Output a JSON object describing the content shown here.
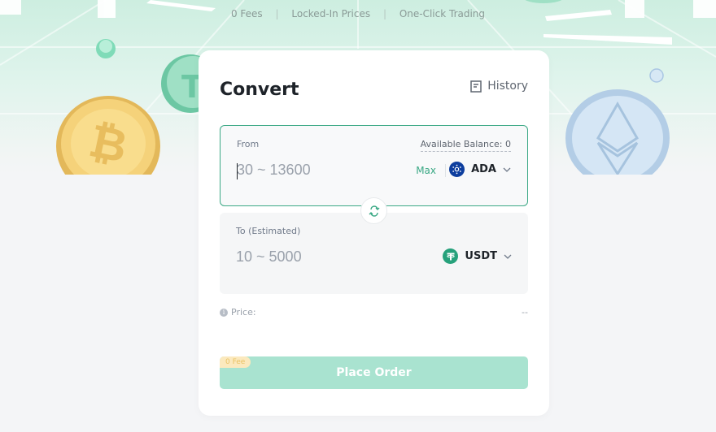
{
  "features": [
    "0 Fees",
    "Locked-In Prices",
    "One-Click Trading"
  ],
  "convert": {
    "title": "Convert",
    "history_label": "History",
    "from": {
      "label": "From",
      "balance": "Available Balance: 0",
      "placeholder": "30 ~ 13600",
      "max_label": "Max",
      "coin": "ADA"
    },
    "to": {
      "label": "To (Estimated)",
      "placeholder": "10 ~ 5000",
      "coin": "USDT"
    },
    "price_label": "Price:",
    "price_value": "--",
    "fee_badge": "0 Fee",
    "order_button": "Place Order"
  },
  "colors": {
    "accent": "#3aa884",
    "order_button_bg": "#a9e3d0",
    "ada_logo": "#0d3e9e",
    "usdt_logo": "#26a17b"
  },
  "icons": [
    "history-icon",
    "swap-icon",
    "ada-logo-icon",
    "usdt-logo-icon",
    "chevron-down-icon",
    "info-icon",
    "bitcoin-coin-icon",
    "tether-coin-icon",
    "ethereum-coin-icon"
  ]
}
